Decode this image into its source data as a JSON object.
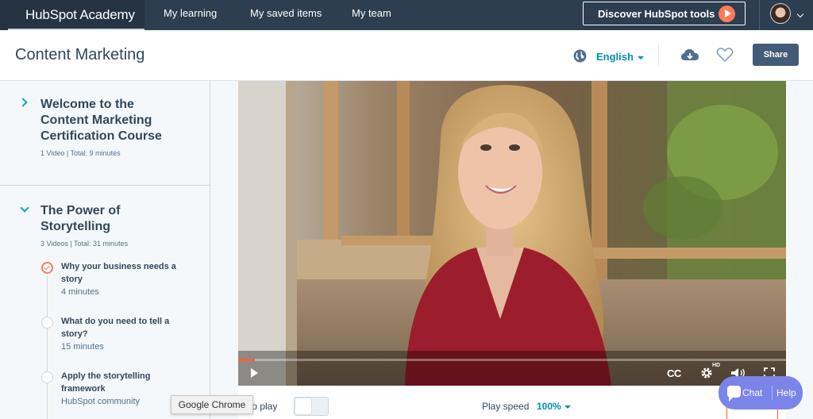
{
  "nav": {
    "brand": "HubSpot Academy",
    "links": [
      "My learning",
      "My saved items",
      "My team"
    ],
    "discover_label": "Discover HubSpot tools"
  },
  "header": {
    "course_title": "Content Marketing",
    "language": "English",
    "share_label": "Share"
  },
  "sidebar": {
    "sections": [
      {
        "title": "Welcome to the Content Marketing Certification Course",
        "meta": "1 Video | Total: 9 minutes"
      },
      {
        "title": "The Power of Storytelling",
        "meta": "3 Videos | Total: 31 minutes",
        "lessons": [
          {
            "title": "Why your business needs a story",
            "duration": "4 minutes",
            "status": "in-progress"
          },
          {
            "title": "What do you need to tell a story?",
            "duration": "15 minutes",
            "status": "not-started"
          },
          {
            "title": "Apply the storytelling framework",
            "duration": "HubSpot community",
            "status": "not-started"
          }
        ]
      }
    ]
  },
  "player": {
    "progress": 0.03,
    "cc_label": "CC",
    "hd_label": "HD"
  },
  "bottombar": {
    "autoplay_label": "Auto play",
    "autoplay_visible": "to play",
    "speed_label": "Play speed",
    "speed_value": "100%"
  },
  "tooltip": "Google Chrome",
  "chat": {
    "chat_label": "Chat",
    "help_label": "Help"
  },
  "colors": {
    "nav_bg": "#2d3e50",
    "accent_orange": "#ff7a59",
    "link_teal": "#0091ae",
    "share_bg": "#425b76",
    "chat_bg": "#7b84e8"
  }
}
